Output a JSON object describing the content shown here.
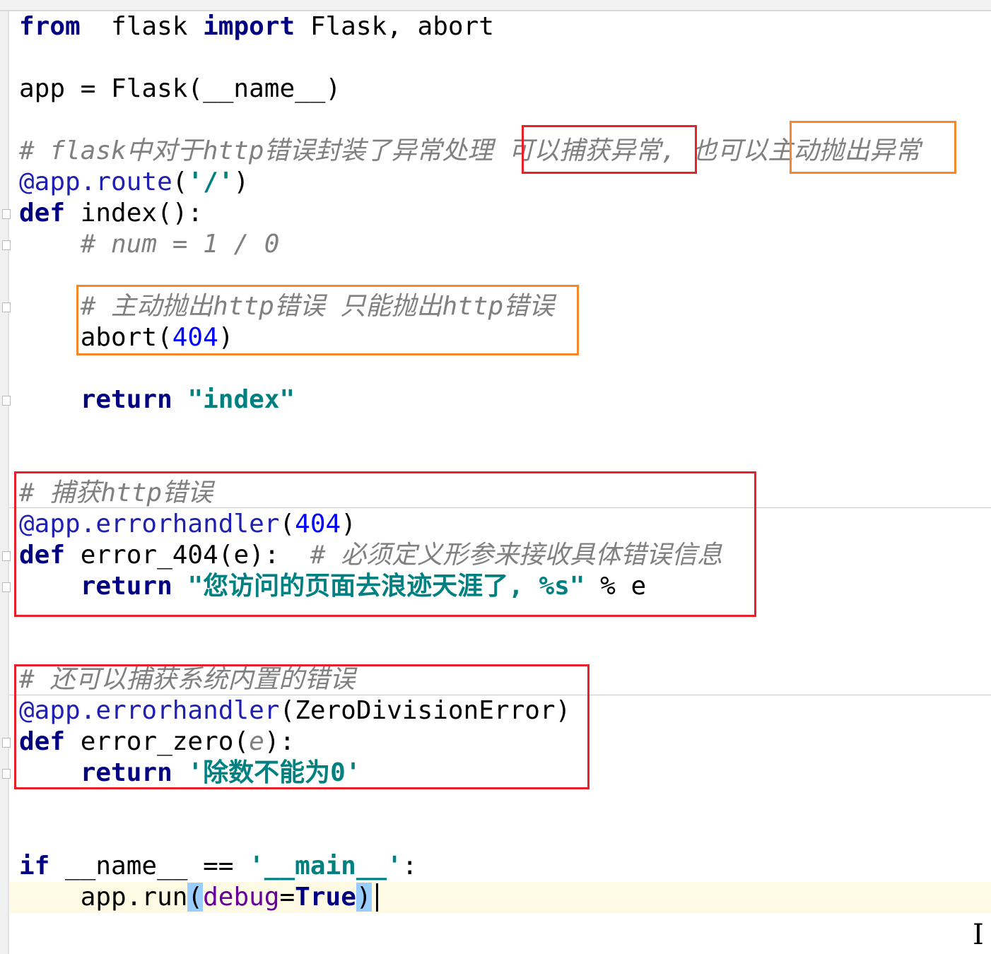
{
  "editor": {
    "language": "python",
    "colors": {
      "keyword": "#000080",
      "string": "#008080",
      "comment": "#808080",
      "number": "#0000ff",
      "decorator": "#1f1fb0",
      "param": "#660099",
      "current_line": "#fffae3",
      "box_red": "#e8202a",
      "box_orange": "#f5892a"
    },
    "lines": [
      [
        [
          "kw",
          "from"
        ],
        [
          "",
          "  flask "
        ],
        [
          "kw",
          "import"
        ],
        [
          "",
          " Flask, abort"
        ]
      ],
      [],
      [
        [
          "",
          "app = Flask(__name__)"
        ]
      ],
      [],
      [
        [
          "cm",
          "# flask中对于http错误封装了异常处理 可以捕获异常, 也可以主动抛出异常"
        ]
      ],
      [
        [
          "dec",
          "@app.route"
        ],
        [
          "",
          "("
        ],
        [
          "str",
          "'/'"
        ],
        [
          "",
          ")"
        ]
      ],
      [
        [
          "kw",
          "def"
        ],
        [
          "",
          " index():"
        ]
      ],
      [
        [
          "",
          "    "
        ],
        [
          "cm",
          "# num = 1 / 0"
        ]
      ],
      [],
      [
        [
          "",
          "    "
        ],
        [
          "cm",
          "# 主动抛出http错误 只能抛出http错误"
        ]
      ],
      [
        [
          "",
          "    abort("
        ],
        [
          "num",
          "404"
        ],
        [
          "",
          ")"
        ]
      ],
      [],
      [
        [
          "",
          "    "
        ],
        [
          "kw",
          "return"
        ],
        [
          "",
          " "
        ],
        [
          "str",
          "\"index\""
        ]
      ],
      [],
      [],
      [
        [
          "cm",
          "# 捕获http错误"
        ]
      ],
      [
        [
          "dec",
          "@app.errorhandler"
        ],
        [
          "",
          "("
        ],
        [
          "num",
          "404"
        ],
        [
          "",
          ")"
        ]
      ],
      [
        [
          "kw",
          "def"
        ],
        [
          "",
          " error_404(e):  "
        ],
        [
          "cm",
          "# 必须定义形参来接收具体错误信息"
        ]
      ],
      [
        [
          "",
          "    "
        ],
        [
          "kw",
          "return"
        ],
        [
          "",
          " "
        ],
        [
          "str",
          "\"您访问的页面去浪迹天涯了, %s\""
        ],
        [
          "",
          " % e"
        ]
      ],
      [],
      [],
      [
        [
          "cm",
          "# 还可以捕获系统内置的错误"
        ]
      ],
      [
        [
          "dec",
          "@app.errorhandler"
        ],
        [
          "",
          "(ZeroDivisionError)"
        ]
      ],
      [
        [
          "kw",
          "def"
        ],
        [
          "",
          " error_zero("
        ],
        [
          "cm",
          "e"
        ],
        [
          "",
          "):"
        ]
      ],
      [
        [
          "",
          "    "
        ],
        [
          "kw",
          "return"
        ],
        [
          "",
          " "
        ],
        [
          "str",
          "'除数不能为0'"
        ]
      ],
      [],
      [],
      [
        [
          "kw",
          "if"
        ],
        [
          "",
          " __name__ == "
        ],
        [
          "str",
          "'__main__'"
        ],
        [
          "",
          ":"
        ]
      ],
      [
        [
          "",
          "    app.run"
        ],
        [
          "brace",
          "("
        ],
        [
          "par",
          "debug"
        ],
        [
          "",
          "="
        ],
        [
          "kw",
          "True"
        ],
        [
          "brace",
          ")"
        ]
      ]
    ]
  }
}
